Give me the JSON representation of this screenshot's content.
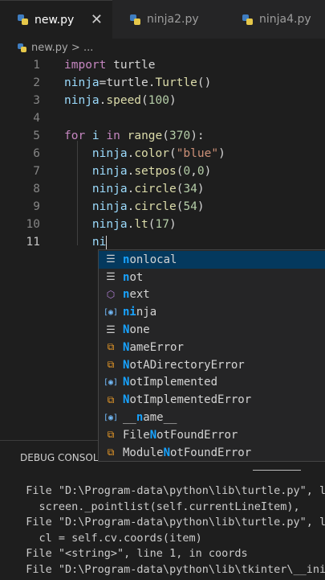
{
  "tabs": [
    {
      "label": "new.py",
      "active": true,
      "close": "✕"
    },
    {
      "label": "ninja2.py",
      "active": false
    },
    {
      "label": "ninja4.py",
      "active": false
    }
  ],
  "breadcrumb": {
    "file": "new.py",
    "separator": ">",
    "rest": "..."
  },
  "code_lines": [
    {
      "n": "1",
      "tokens": [
        {
          "t": "import",
          "c": "kw"
        },
        {
          "t": " turtle",
          "c": "pl"
        }
      ]
    },
    {
      "n": "2",
      "tokens": [
        {
          "t": "ninja",
          "c": "id"
        },
        {
          "t": "=turtle.",
          "c": "pl"
        },
        {
          "t": "Turtle",
          "c": "fn"
        },
        {
          "t": "()",
          "c": "pl"
        }
      ]
    },
    {
      "n": "3",
      "tokens": [
        {
          "t": "ninja",
          "c": "id"
        },
        {
          "t": ".",
          "c": "pl"
        },
        {
          "t": "speed",
          "c": "fn"
        },
        {
          "t": "(",
          "c": "pl"
        },
        {
          "t": "100",
          "c": "num"
        },
        {
          "t": ")",
          "c": "pl"
        }
      ]
    },
    {
      "n": "4",
      "tokens": []
    },
    {
      "n": "5",
      "tokens": [
        {
          "t": "for",
          "c": "kw"
        },
        {
          "t": " i ",
          "c": "id"
        },
        {
          "t": "in",
          "c": "kw"
        },
        {
          "t": " ",
          "c": "pl"
        },
        {
          "t": "range",
          "c": "fn"
        },
        {
          "t": "(",
          "c": "pl"
        },
        {
          "t": "370",
          "c": "num"
        },
        {
          "t": "):",
          "c": "pl"
        }
      ]
    },
    {
      "n": "6",
      "tokens": [
        {
          "t": "    ninja",
          "c": "id"
        },
        {
          "t": ".",
          "c": "pl"
        },
        {
          "t": "color",
          "c": "fn"
        },
        {
          "t": "(",
          "c": "pl"
        },
        {
          "t": "\"blue\"",
          "c": "str"
        },
        {
          "t": ")",
          "c": "pl"
        }
      ]
    },
    {
      "n": "7",
      "tokens": [
        {
          "t": "    ninja",
          "c": "id"
        },
        {
          "t": ".",
          "c": "pl"
        },
        {
          "t": "setpos",
          "c": "fn"
        },
        {
          "t": "(",
          "c": "pl"
        },
        {
          "t": "0",
          "c": "num"
        },
        {
          "t": ",",
          "c": "pl"
        },
        {
          "t": "0",
          "c": "num"
        },
        {
          "t": ")",
          "c": "pl"
        }
      ]
    },
    {
      "n": "8",
      "tokens": [
        {
          "t": "    ninja",
          "c": "id"
        },
        {
          "t": ".",
          "c": "pl"
        },
        {
          "t": "circle",
          "c": "fn"
        },
        {
          "t": "(",
          "c": "pl"
        },
        {
          "t": "34",
          "c": "num"
        },
        {
          "t": ")",
          "c": "pl"
        }
      ]
    },
    {
      "n": "9",
      "tokens": [
        {
          "t": "    ninja",
          "c": "id"
        },
        {
          "t": ".",
          "c": "pl"
        },
        {
          "t": "circle",
          "c": "fn"
        },
        {
          "t": "(",
          "c": "pl"
        },
        {
          "t": "54",
          "c": "num"
        },
        {
          "t": ")",
          "c": "pl"
        }
      ]
    },
    {
      "n": "10",
      "tokens": [
        {
          "t": "    ninja",
          "c": "id"
        },
        {
          "t": ".",
          "c": "pl"
        },
        {
          "t": "lt",
          "c": "fn"
        },
        {
          "t": "(",
          "c": "pl"
        },
        {
          "t": "17",
          "c": "num"
        },
        {
          "t": ")",
          "c": "pl"
        }
      ]
    },
    {
      "n": "11",
      "tokens": [
        {
          "t": "    ni",
          "c": "id"
        }
      ],
      "cursor": true
    }
  ],
  "suggestions": [
    {
      "icon": "keyword-icon",
      "match": "n",
      "rest": "onlocal",
      "selected": true
    },
    {
      "icon": "keyword-icon",
      "match": "n",
      "rest": "ot"
    },
    {
      "icon": "module-icon",
      "match": "n",
      "rest": "ext"
    },
    {
      "icon": "variable-icon",
      "match": "ni",
      "rest": "nja"
    },
    {
      "icon": "keyword-icon",
      "match": "N",
      "rest": "one"
    },
    {
      "icon": "class-icon",
      "match": "N",
      "rest": "ameError"
    },
    {
      "icon": "class-icon",
      "match": "N",
      "rest": "otADirectoryError"
    },
    {
      "icon": "variable-icon",
      "match": "N",
      "rest": "otImplemented"
    },
    {
      "icon": "class-icon",
      "match": "N",
      "rest": "otImplementedError"
    },
    {
      "icon": "variable-icon",
      "pre": "__",
      "match": "n",
      "rest": "ame__"
    },
    {
      "icon": "class-icon",
      "pre": "File",
      "match": "N",
      "rest": "otFoundError"
    },
    {
      "icon": "class-icon",
      "pre": "Module",
      "match": "N",
      "rest": "otFoundError"
    }
  ],
  "panel": {
    "tab_label": "DEBUG CONSOLE",
    "output": [
      "  File \"D:\\Program-data\\python\\lib\\turtle.py\", l",
      "    screen._pointlist(self.currentLineItem),",
      "  File \"D:\\Program-data\\python\\lib\\turtle.py\", l",
      "    cl = self.cv.coords(item)",
      "  File \"<string>\", line 1, in coords",
      "  File \"D:\\Program-data\\python\\lib\\tkinter\\__ini"
    ]
  },
  "colors": {
    "editor_bg": "#1e1e1e",
    "keyword": "#c586c0",
    "function": "#dcdcaa",
    "number": "#b5cea8",
    "string": "#ce9178",
    "identifier": "#9cdcfe",
    "suggest_selected": "#04395e",
    "match_highlight": "#18a3ff"
  }
}
